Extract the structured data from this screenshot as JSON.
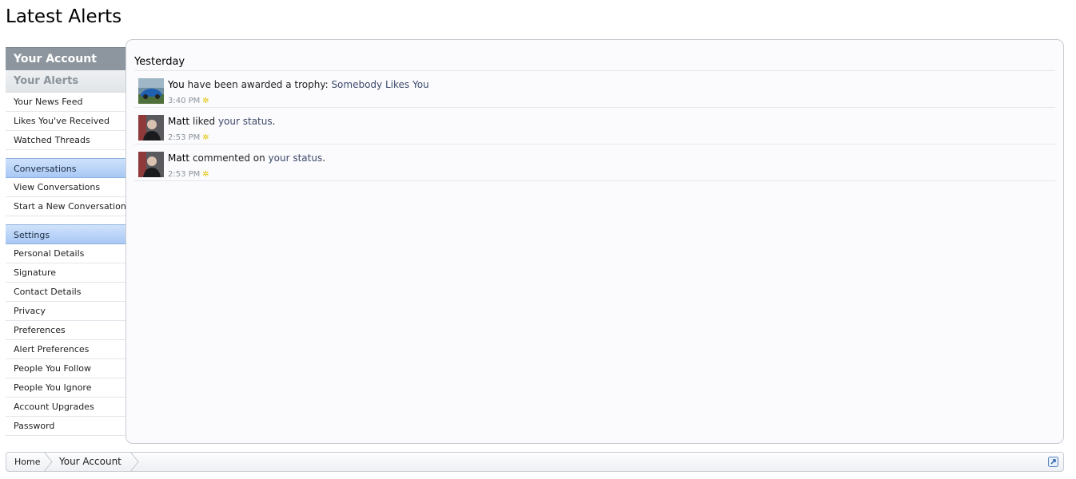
{
  "page": {
    "title": "Latest Alerts"
  },
  "sidebar": {
    "header": "Your Account",
    "selected": "Your Alerts",
    "items": [
      "Your News Feed",
      "Likes You've Received",
      "Watched Threads"
    ],
    "conversations": {
      "title": "Conversations",
      "items": [
        "View Conversations",
        "Start a New Conversation"
      ]
    },
    "settings": {
      "title": "Settings",
      "items": [
        "Personal Details",
        "Signature",
        "Contact Details",
        "Privacy",
        "Preferences",
        "Alert Preferences",
        "People You Follow",
        "People You Ignore",
        "Account Upgrades",
        "Password"
      ]
    }
  },
  "alerts": {
    "day_heading": "Yesterday",
    "list": [
      {
        "user": "You",
        "action": " have been awarded a trophy: ",
        "target": "Somebody Likes You",
        "tail": "",
        "time": "3:40 PM",
        "avatar": "car-avatar"
      },
      {
        "user": "Matt",
        "action": " liked ",
        "target": "your status",
        "tail": ".",
        "time": "2:53 PM",
        "avatar": "person-avatar"
      },
      {
        "user": "Matt",
        "action": " commented on ",
        "target": "your status",
        "tail": ".",
        "time": "2:53 PM",
        "avatar": "person-avatar"
      }
    ]
  },
  "breadcrumb": {
    "home": "Home",
    "current": "Your Account"
  },
  "colors": {
    "section_blue": "#a8c8f5",
    "header_gray": "#8d969e",
    "link": "#3d4a6b"
  }
}
